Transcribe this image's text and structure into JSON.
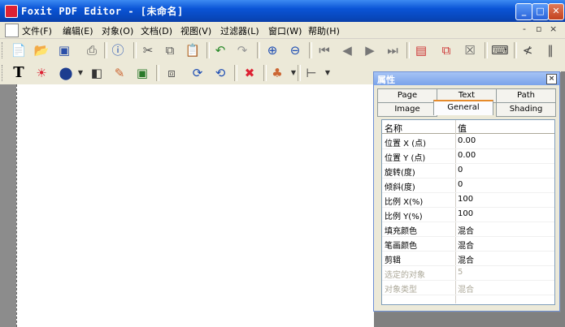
{
  "window": {
    "title": "Foxit PDF Editor - [未命名]",
    "buttons": {
      "minimize": "_",
      "maximize": "□",
      "close": "✕"
    }
  },
  "menu": {
    "items": [
      "文件(F)",
      "编辑(E)",
      "对象(O)",
      "文档(D)",
      "视图(V)",
      "过滤器(L)",
      "窗口(W)",
      "帮助(H)"
    ],
    "mdi": [
      "-",
      "▫",
      "×"
    ]
  },
  "toolbar1": {
    "icons": [
      "new-document-icon",
      "open-folder-icon",
      "save-icon",
      "print-icon",
      "info-icon",
      "cut-icon",
      "copy-icon",
      "paste-icon",
      "undo-icon",
      "redo-icon",
      "zoom-in-icon",
      "zoom-out-icon",
      "first-page-icon",
      "prev-page-icon",
      "next-page-icon",
      "last-page-icon",
      "properties-icon",
      "extract-icon",
      "delete-page-icon",
      "keyboard-icon",
      "text-format-icon",
      "columns-icon"
    ]
  },
  "toolbar2": {
    "icons": [
      "text-tool-icon",
      "image-tool-icon",
      "shape-tool-icon",
      "path-tool-icon",
      "edit-object-icon",
      "object-props-icon",
      "select-icon",
      "rotate-cw-icon",
      "rotate-ccw-icon",
      "delete-object-icon",
      "group-icon",
      "align-icon"
    ]
  },
  "panel": {
    "title": "属性",
    "tabs_top": [
      "Page",
      "Text",
      "Path"
    ],
    "tabs_bottom": [
      "Image",
      "General",
      "Shading"
    ],
    "active_tab": "General",
    "grid_header": {
      "name": "名称",
      "value": "值"
    },
    "rows": [
      {
        "name": "位置 X (点)",
        "value": "0.00",
        "disabled": false
      },
      {
        "name": "位置 Y (点)",
        "value": "0.00",
        "disabled": false
      },
      {
        "name": "旋转(度)",
        "value": "0",
        "disabled": false
      },
      {
        "name": "倾斜(度)",
        "value": "0",
        "disabled": false
      },
      {
        "name": "比例 X(%)",
        "value": "100",
        "disabled": false
      },
      {
        "name": "比例 Y(%)",
        "value": "100",
        "disabled": false
      },
      {
        "name": "填充颜色",
        "value": "混合",
        "disabled": false
      },
      {
        "name": "笔画颜色",
        "value": "混合",
        "disabled": false
      },
      {
        "name": "剪辑",
        "value": "混合",
        "disabled": false
      },
      {
        "name": "选定的对象",
        "value": "5",
        "disabled": true
      },
      {
        "name": "对象类型",
        "value": "混合",
        "disabled": true
      }
    ]
  },
  "colors": {
    "titlebar": "#0a54d6",
    "face": "#ece9d8",
    "workspace": "#808080",
    "accent_tab": "#e68b2c"
  }
}
